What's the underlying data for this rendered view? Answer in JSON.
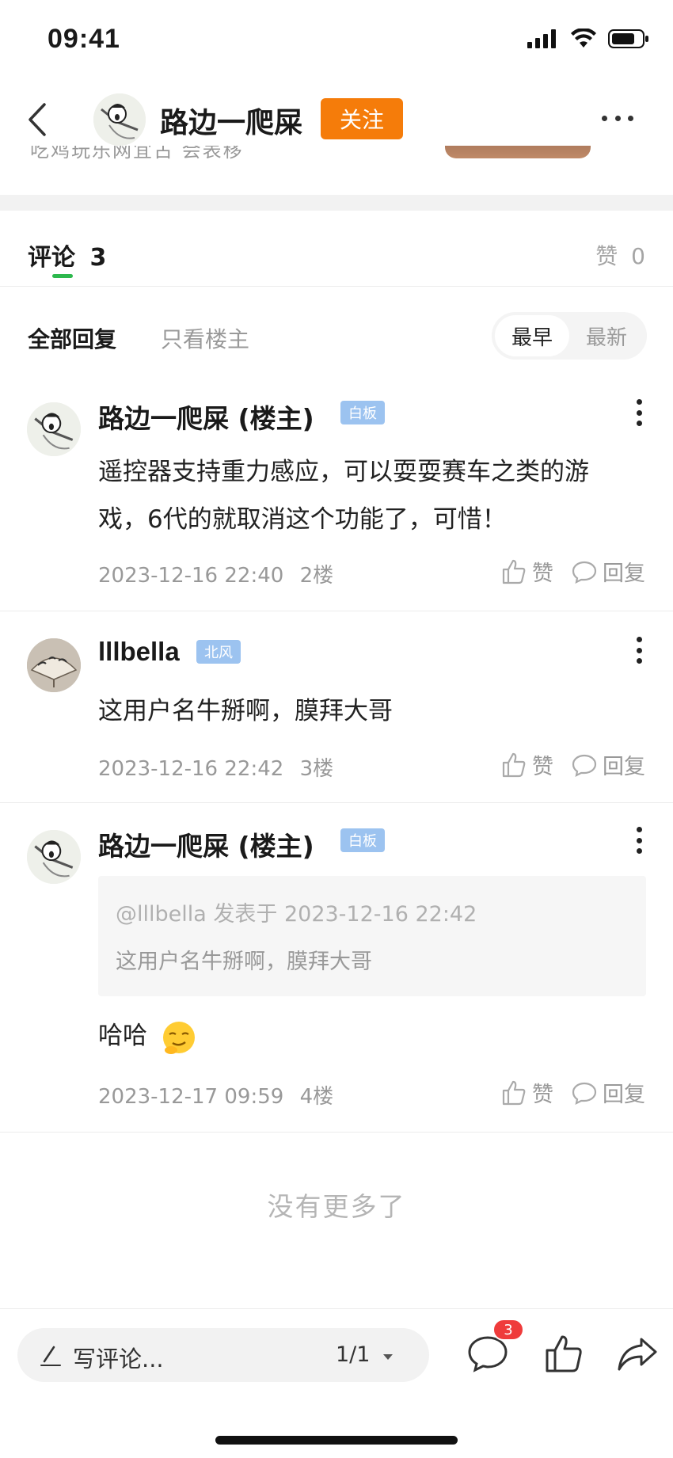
{
  "status_bar": {
    "time": "09:41"
  },
  "header": {
    "author_name": "路边一爬屎",
    "follow_label": "关注",
    "peek_text": "吃鸡玩乐网宜古 会表移"
  },
  "comments_section": {
    "title": "评论",
    "count": "3",
    "like_label": "赞",
    "like_count": "0"
  },
  "filters": {
    "all_replies": "全部回复",
    "only_op": "只看楼主",
    "sort_options": [
      "最早",
      "最新"
    ],
    "sort_selected": "最早"
  },
  "comments": [
    {
      "name": "路边一爬屎 (楼主)",
      "badge": "白板",
      "text": "遥控器支持重力感应，可以耍耍赛车之类的游戏，6代的就取消这个功能了，可惜！",
      "time": "2023-12-16 22:40",
      "floor": "2楼",
      "like_label": "赞",
      "reply_label": "回复"
    },
    {
      "name": "lllbella",
      "badge": "北风",
      "text": "这用户名牛掰啊，膜拜大哥",
      "time": "2023-12-16 22:42",
      "floor": "3楼",
      "like_label": "赞",
      "reply_label": "回复"
    },
    {
      "name": "路边一爬屎 (楼主)",
      "badge": "白板",
      "quote_header": "@lllbella 发表于 2023-12-16 22:42",
      "quote_text": "这用户名牛掰啊，膜拜大哥",
      "text": "哈哈",
      "time": "2023-12-17 09:59",
      "floor": "4楼",
      "like_label": "赞",
      "reply_label": "回复"
    }
  ],
  "footer_note": "没有更多了",
  "bottom_bar": {
    "write_placeholder": "写评论...",
    "page_indicator": "1/1",
    "comment_badge": "3"
  },
  "colors": {
    "accent_orange": "#f57c0a",
    "tab_green": "#2db84d",
    "badge_blue": "#9cc3f0",
    "notif_red": "#ef3b3b"
  }
}
